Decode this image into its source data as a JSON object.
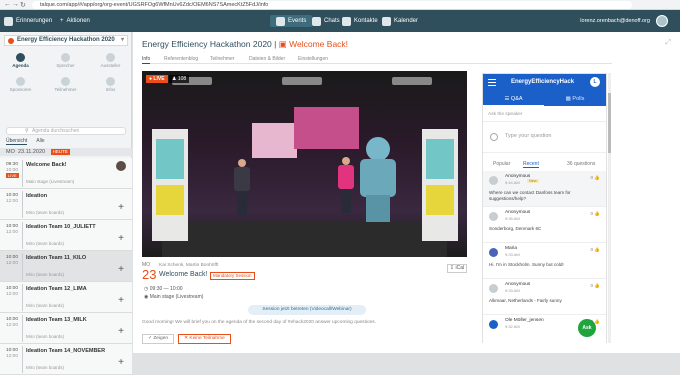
{
  "browser": {
    "url": "talque.com/app/#/app/org/org-event/UGSRFOg6WfMnUv6Zdc/OEM6NS7SAmecKtZ5FdJ/info"
  },
  "topbar": {
    "items": [
      {
        "label": "Erinnerungen"
      },
      {
        "label": "Aktionen"
      },
      {
        "label": "Events"
      },
      {
        "label": "Chats"
      },
      {
        "label": "Kontakte"
      },
      {
        "label": "Kalender"
      }
    ],
    "user": "lorenz.orenbach@denoff.org"
  },
  "sidebar": {
    "event_title": "Energy Efficiency Hackathon 2020",
    "grid": [
      {
        "label": "Agenda",
        "icon": "calendar-icon"
      },
      {
        "label": "Sprecher",
        "icon": "speaker-icon"
      },
      {
        "label": "Aussteller",
        "icon": "exhibitor-icon"
      },
      {
        "label": "Sponsoren",
        "icon": "sponsor-icon"
      },
      {
        "label": "Teilnehmer",
        "icon": "people-icon"
      },
      {
        "label": "Infos",
        "icon": "info-icon"
      }
    ],
    "search_placeholder": "Agenda durchsuchen",
    "filter_tabs": [
      "Übersicht",
      "Alle"
    ],
    "day": "MO",
    "date": "23.11.2020",
    "today": "HEUTE",
    "agenda": [
      {
        "start": "09:30",
        "end": "10:00",
        "title": "Welcome Back!",
        "stage": "Main stage (Livestream)",
        "live": "LIVE"
      },
      {
        "start": "10:00",
        "end": "12:00",
        "title": "Ideation",
        "stage": "Miro (team boards)"
      },
      {
        "start": "10:00",
        "end": "12:00",
        "title": "Ideation Team 10_JULIETT",
        "stage": "Miro (team boards)"
      },
      {
        "start": "10:00",
        "end": "12:00",
        "title": "Ideation Team 11_KILO",
        "stage": "Miro (team boards)"
      },
      {
        "start": "10:00",
        "end": "12:00",
        "title": "Ideation Team 12_LIMA",
        "stage": "Miro (team boards)"
      },
      {
        "start": "10:00",
        "end": "12:00",
        "title": "Ideation Team 13_MILK",
        "stage": "Miro (team boards)"
      },
      {
        "start": "10:00",
        "end": "12:00",
        "title": "Ideation Team 14_NOVEMBER",
        "stage": "Miro (team boards)"
      }
    ]
  },
  "main": {
    "title": "Energy Efficiency Hackathon 2020",
    "session": "Welcome Back!",
    "tabs": [
      "Info",
      "Referentenblog",
      "Teilnehmer",
      "Dateien & Bilder",
      "Einstellungen"
    ],
    "live_badge": "LIVE",
    "viewers": "108",
    "day": "MO",
    "day_num": "23",
    "speakers": "Kai Schenk, Martin Bonhöfft",
    "mandatory": "Mandatory Session",
    "ical": "iCal",
    "time": "09:30 — 10:00",
    "location": "Main stage (Livestream)",
    "join": "Session jetzt betreten (Videocall/Webinar)",
    "description": "Good morning! We will brief you on the agenda of the second day of #ehack2020 answer upcoming questions.",
    "btn_show": "Zeigen",
    "btn_noparticipate": "Keine Teilnahme"
  },
  "chat": {
    "name": "EnergyEfficiencyHack",
    "avatar": "L",
    "tab_qa": "Q&A",
    "tab_polls": "Polls",
    "ask_label": "Ask the speaker",
    "placeholder": "Type your question",
    "sort_popular": "Popular",
    "sort_recent": "Recent",
    "count": "36 questions",
    "messages": [
      {
        "name": "Anonymous",
        "time": "9:44 AM",
        "tag": "New",
        "text": "Where can we contact Danfoss team for suggestions/help?",
        "likes": "0"
      },
      {
        "name": "Anonymous",
        "time": "9:35 AM",
        "text": "Sonderborg, Denmark 6C",
        "likes": "0"
      },
      {
        "name": "Maria",
        "time": "9:33 AM",
        "text": "Hi. I'm in Stockholm. Sunny but cold!",
        "likes": "0"
      },
      {
        "name": "Anonymous",
        "time": "9:33 AM",
        "text": "Alkmaar, Netherlands - Fairly sunny",
        "likes": "0"
      },
      {
        "name": "Ole Möller_jensen",
        "time": "9:32 AM",
        "text": "",
        "likes": "0"
      }
    ],
    "ask_fab": "Ask"
  }
}
